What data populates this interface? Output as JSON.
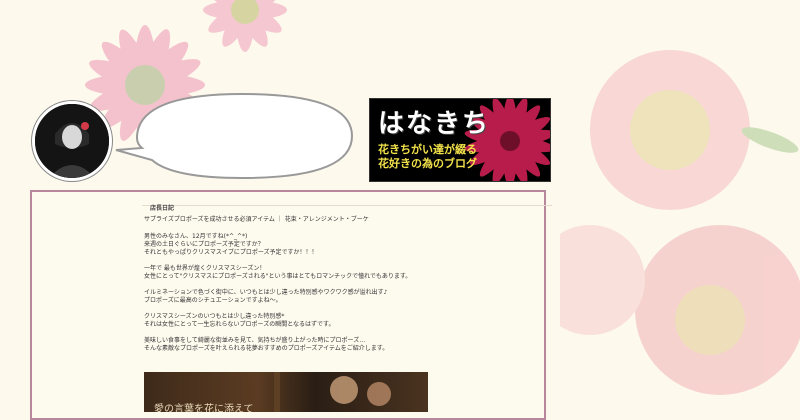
{
  "banner": {
    "title": "はなきち",
    "subtitle_line1": "花きちがい達が綴る",
    "subtitle_line2": "花好きの為のブログ"
  },
  "blog": {
    "header_label": "店長日記",
    "title": "サプライズプロポーズを成功させる必須アイテム ｜ 花束・アレンジメント・ブーケ",
    "paragraphs": [
      [
        "男性のみなさん、12月ですね(*^_^*)",
        "来週の土日ぐらいにプロポーズ予定ですか？",
        "それともやっぱりクリスマスイブにプロポーズ予定ですか！！！"
      ],
      [
        "一年で 最も世界が煌くクリスマスシーズン！",
        "女性にとって\"クリスマスにプロポーズされる\"という事はとてもロマンチックで憧れでもあります。"
      ],
      [
        "イルミネーションで色づく街中に、いつもとは少し違った特別感やワクワク感が溢れ出す♪",
        "プロポーズに最高のシチュエーションですよね～。"
      ],
      [
        "クリスマスシーズンのいつもとは少し違った特別感*",
        "それは女性にとって一生忘れらないプロポーズの瞬間となるはずです。"
      ],
      [
        "美味しい食事をして綺麗な街並みを見て、気持ちが盛り上がった時にプロポーズ…",
        "そんな素敵なプロポーズを叶えられる花夢おすすめのプロポーズアイテムをご紹介します。"
      ]
    ],
    "image_caption": "愛の言葉を花に添えて"
  }
}
